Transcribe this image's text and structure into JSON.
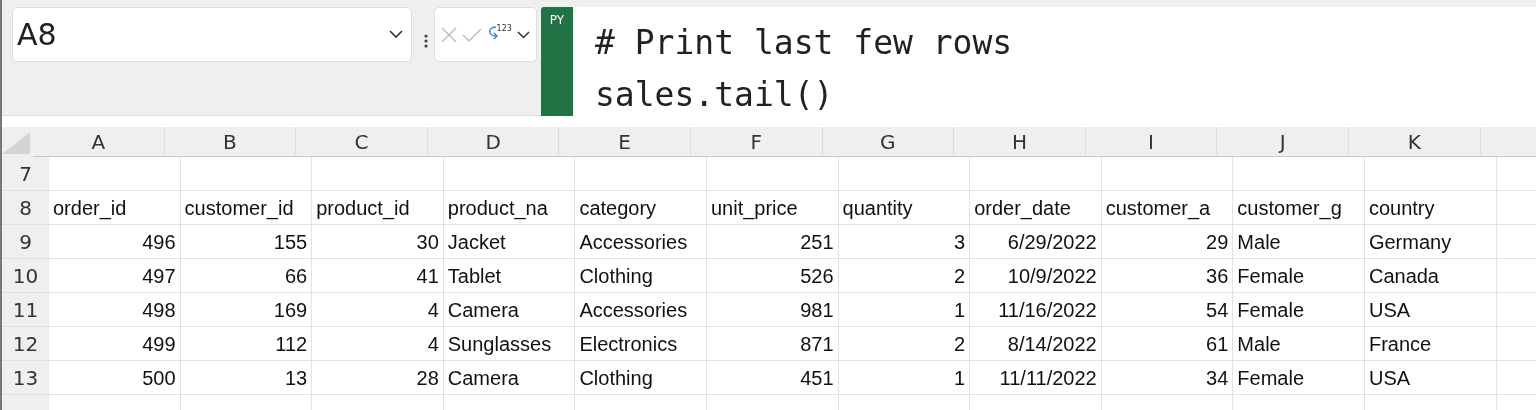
{
  "name_box": {
    "value": "A8"
  },
  "formula_bar": {
    "badge": "PY",
    "number_format_label": "123",
    "code_lines": [
      "# Print last few rows",
      "sales.tail()"
    ]
  },
  "columns": [
    {
      "letter": "A",
      "kind": "number"
    },
    {
      "letter": "B",
      "kind": "number"
    },
    {
      "letter": "C",
      "kind": "number"
    },
    {
      "letter": "D",
      "kind": "text"
    },
    {
      "letter": "E",
      "kind": "text"
    },
    {
      "letter": "F",
      "kind": "number"
    },
    {
      "letter": "G",
      "kind": "number"
    },
    {
      "letter": "H",
      "kind": "number"
    },
    {
      "letter": "I",
      "kind": "number"
    },
    {
      "letter": "J",
      "kind": "text"
    },
    {
      "letter": "K",
      "kind": "text"
    }
  ],
  "rows": [
    {
      "label": "7",
      "kind": "data",
      "cells": []
    },
    {
      "label": "8",
      "kind": "header",
      "cells": [
        "order_id",
        "customer_id",
        "product_id",
        "product_na",
        "category",
        "unit_price",
        "quantity",
        "order_date",
        "customer_a",
        "customer_g",
        "country"
      ]
    },
    {
      "label": "9",
      "kind": "data",
      "cells": [
        "496",
        "155",
        "30",
        "Jacket",
        "Accessories",
        "251",
        "3",
        "6/29/2022",
        "29",
        "Male",
        "Germany"
      ]
    },
    {
      "label": "10",
      "kind": "data",
      "cells": [
        "497",
        "66",
        "41",
        "Tablet",
        "Clothing",
        "526",
        "2",
        "10/9/2022",
        "36",
        "Female",
        "Canada"
      ]
    },
    {
      "label": "11",
      "kind": "data",
      "cells": [
        "498",
        "169",
        "4",
        "Camera",
        "Accessories",
        "981",
        "1",
        "11/16/2022",
        "54",
        "Female",
        "USA"
      ]
    },
    {
      "label": "12",
      "kind": "data",
      "cells": [
        "499",
        "112",
        "4",
        "Sunglasses",
        "Electronics",
        "871",
        "2",
        "8/14/2022",
        "61",
        "Male",
        "France"
      ]
    },
    {
      "label": "13",
      "kind": "data",
      "cells": [
        "500",
        "13",
        "28",
        "Camera",
        "Clothing",
        "451",
        "1",
        "11/11/2022",
        "34",
        "Female",
        "USA"
      ]
    },
    {
      "kind": "data",
      "cells": []
    }
  ]
}
